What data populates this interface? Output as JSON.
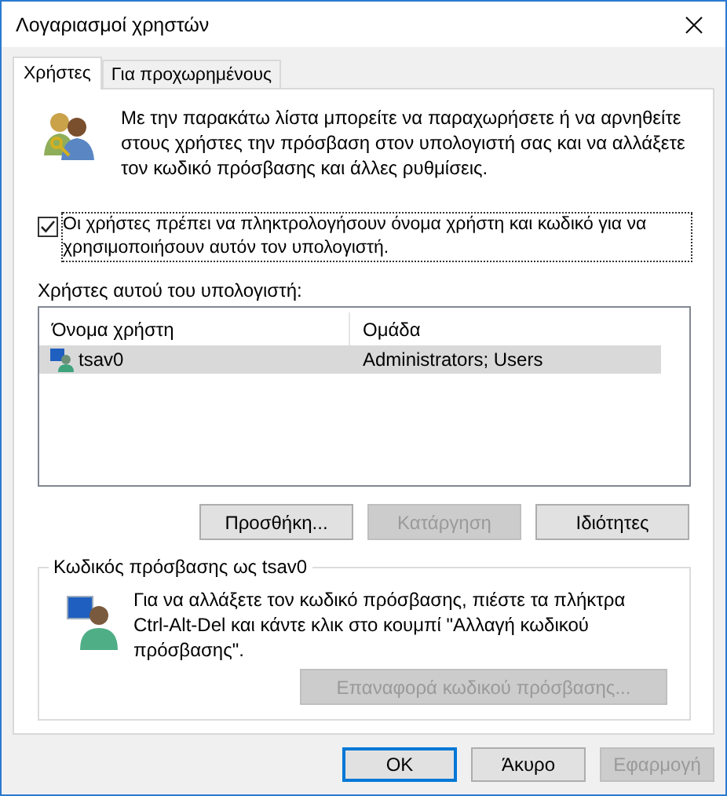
{
  "window": {
    "title": "Λογαριασμοί χρηστών"
  },
  "tabs": [
    {
      "label": "Χρήστες",
      "selected": true
    },
    {
      "label": "Για προχωρημένους",
      "selected": false
    }
  ],
  "intro": {
    "text": "Με την παρακάτω λίστα μπορείτε να παραχωρήσετε ή να αρνηθείτε στους χρήστες την πρόσβαση στον υπολογιστή σας και να αλλάξετε τον κωδικό πρόσβασης και άλλες ρυθμίσεις."
  },
  "require_login": {
    "label": "Οι χρήστες πρέπει να πληκτρολογήσουν όνομα χρήστη και κωδικό για να χρησιμοποιήσουν αυτόν τον υπολογιστή.",
    "checked": true
  },
  "users_label": "Χρήστες αυτού του υπολογιστή:",
  "users_table": {
    "columns": [
      "Όνομα χρήστη",
      "Ομάδα"
    ],
    "rows": [
      {
        "cells": [
          "tsav0",
          "Administrators; Users"
        ],
        "selected": true
      }
    ]
  },
  "user_buttons": [
    {
      "label": "Προσθήκη...",
      "disabled": false
    },
    {
      "label": "Κατάργηση",
      "disabled": true
    },
    {
      "label": "Ιδιότητες",
      "disabled": false
    }
  ],
  "password_group": {
    "title": "Κωδικός πρόσβασης ως tsav0",
    "text": "Για να αλλάξετε τον κωδικό πρόσβασης, πιέστε τα πλήκτρα Ctrl-Alt-Del και κάντε κλικ στο κουμπί \"Αλλαγή κωδικού πρόσβασης\".",
    "reset_button": {
      "label": "Επαναφορά κωδικού πρόσβασης...",
      "disabled": true
    }
  },
  "dialog_buttons": [
    {
      "label": "OK",
      "disabled": false,
      "default": true
    },
    {
      "label": "Άκυρο",
      "disabled": false,
      "default": false
    },
    {
      "label": "Εφαρμογή",
      "disabled": true,
      "default": false
    }
  ]
}
